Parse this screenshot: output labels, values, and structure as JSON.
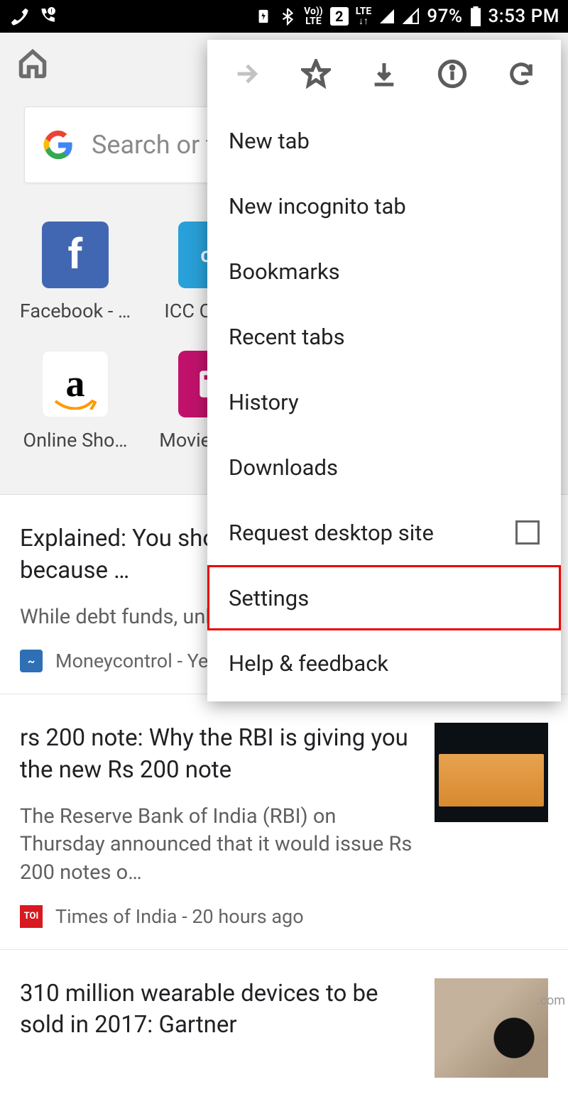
{
  "status": {
    "battery_pct": "97%",
    "time": "3:53 PM",
    "volte": "Vo))\nLTE",
    "lte": "LTE",
    "sim_badge": "2"
  },
  "search": {
    "placeholder": "Search or type a URL"
  },
  "shortcuts": [
    {
      "label": "Facebook - …",
      "iconText": "f",
      "cls": "fb"
    },
    {
      "label": "ICC Cricket",
      "iconText": "cri",
      "cls": "cri"
    },
    {
      "label": "Online Sho…",
      "iconText": "a",
      "cls": "amz"
    },
    {
      "label": "Movie Tick…",
      "iconText": "",
      "cls": "movie"
    }
  ],
  "articles": [
    {
      "title": "Explained: You should invest in debt mutual funds because …",
      "snippet": "While debt funds, unlike small saving schemes",
      "source": "Moneycontrol - Yesterday",
      "srcCls": "src-mc",
      "srcTxt": "~",
      "thumb": null
    },
    {
      "title": "rs 200 note: Why the RBI is giving you the new Rs 200 note",
      "snippet": "The Reserve Bank of India (RBI) on Thursday announced that it would issue Rs 200 notes o…",
      "source": "Times of India - 20 hours ago",
      "srcCls": "src-toi",
      "srcTxt": "TOI",
      "thumb": "note"
    },
    {
      "title": "310 million wearable devices to be sold in 2017: Gartner",
      "snippet": "",
      "source": "",
      "srcCls": "",
      "srcTxt": "",
      "thumb": "watch"
    }
  ],
  "menu": {
    "items": [
      {
        "label": "New tab"
      },
      {
        "label": "New incognito tab"
      },
      {
        "label": "Bookmarks"
      },
      {
        "label": "Recent tabs"
      },
      {
        "label": "History"
      },
      {
        "label": "Downloads"
      },
      {
        "label": "Request desktop site",
        "checkbox": true
      },
      {
        "label": "Settings",
        "highlighted": true
      },
      {
        "label": "Help & feedback"
      }
    ]
  },
  "watermark": ".com"
}
